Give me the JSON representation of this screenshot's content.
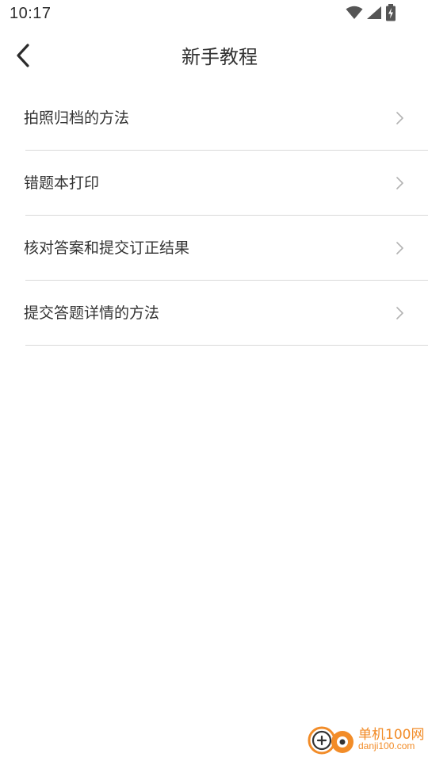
{
  "status_bar": {
    "time": "10:17",
    "icons": [
      "wifi-icon",
      "cellular-signal-icon",
      "battery-charging-icon"
    ]
  },
  "header": {
    "back_icon": "back-arrow-icon",
    "title": "新手教程"
  },
  "menu": {
    "items": [
      {
        "label": "拍照归档的方法",
        "icon": "chevron-right-icon"
      },
      {
        "label": "错题本打印",
        "icon": "chevron-right-icon"
      },
      {
        "label": "核对答案和提交订正结果",
        "icon": "chevron-right-icon"
      },
      {
        "label": "提交答题详情的方法",
        "icon": "chevron-right-icon"
      }
    ]
  },
  "watermark": {
    "text_cn": "单机100网",
    "text_url": "danji100.com"
  },
  "colors": {
    "text": "#333333",
    "divider": "#d9d9d9",
    "chevron": "#b3b3b3",
    "watermark": "#f28c28"
  }
}
